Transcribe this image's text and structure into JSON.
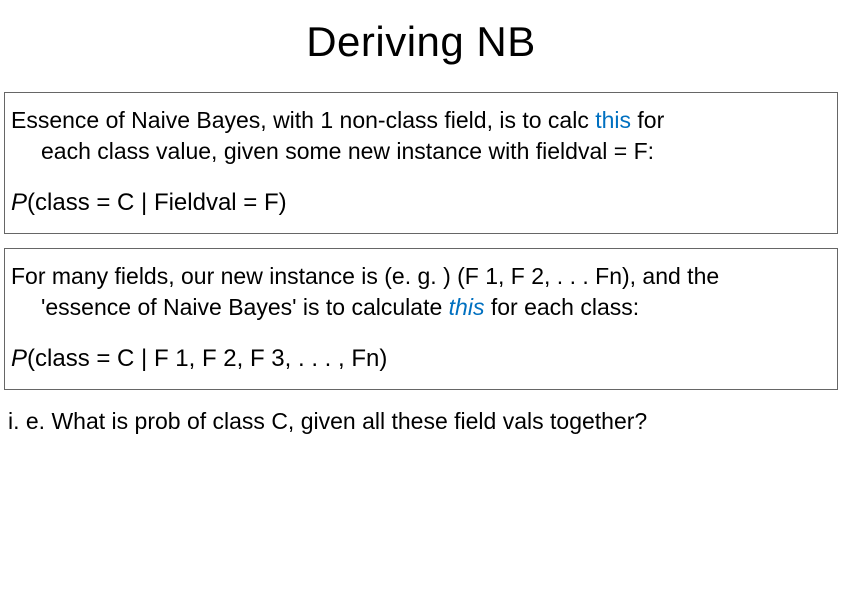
{
  "title": "Deriving NB",
  "box1": {
    "line1a": "Essence of Naive Bayes,   with 1 non-class field, is to calc ",
    "line1_this": "this",
    "line1b": " for",
    "line2": "each class value, given some new instance with fieldval  = F:",
    "formula_P": "P",
    "formula_rest": "(class = C |  Fieldval = F)"
  },
  "box2": {
    "line1": "For many fields, our new instance is (e. g. ) (F 1, F 2, . . . Fn), and the",
    "line2a": "'essence of Naive Bayes' is to calculate ",
    "line2_this": "this",
    "line2b": " for each class:",
    "formula_P": "P",
    "formula_rest": "(class = C | F 1, F 2, F 3, . . . , Fn)"
  },
  "bottom": "i. e.  What is prob of class C, given all these field vals together?"
}
